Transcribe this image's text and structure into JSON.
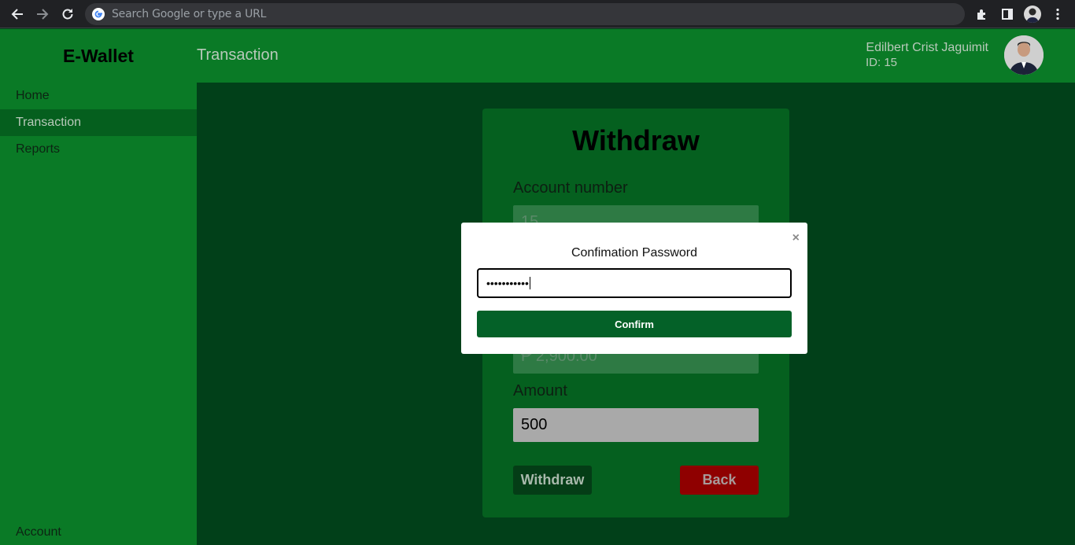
{
  "browser": {
    "omnibox_placeholder": "Search Google or type a URL"
  },
  "app": {
    "brand": "E-Wallet",
    "page_heading": "Transaction",
    "user": {
      "name": "Edilbert Crist Jaguimit",
      "id_label": "ID: 15"
    }
  },
  "sidebar": {
    "items": [
      {
        "label": "Home",
        "active": false
      },
      {
        "label": "Transaction",
        "active": true
      },
      {
        "label": "Reports",
        "active": false
      }
    ],
    "account_label": "Account"
  },
  "withdraw_form": {
    "title": "Withdraw",
    "account_number_label": "Account number",
    "account_number_value": "15",
    "balance_value": "₱ 2,900.00",
    "amount_label": "Amount",
    "amount_value": "500",
    "withdraw_button": "Withdraw",
    "back_button": "Back"
  },
  "modal": {
    "close_glyph": "×",
    "title": "Confimation Password",
    "password_value": "•••••••••••",
    "confirm_button": "Confirm"
  },
  "colors": {
    "header_green": "#0a7a26",
    "main_bg": "#014019",
    "card_bg": "#05601f",
    "confirm_green": "#046128",
    "back_red": "#8f0000"
  }
}
